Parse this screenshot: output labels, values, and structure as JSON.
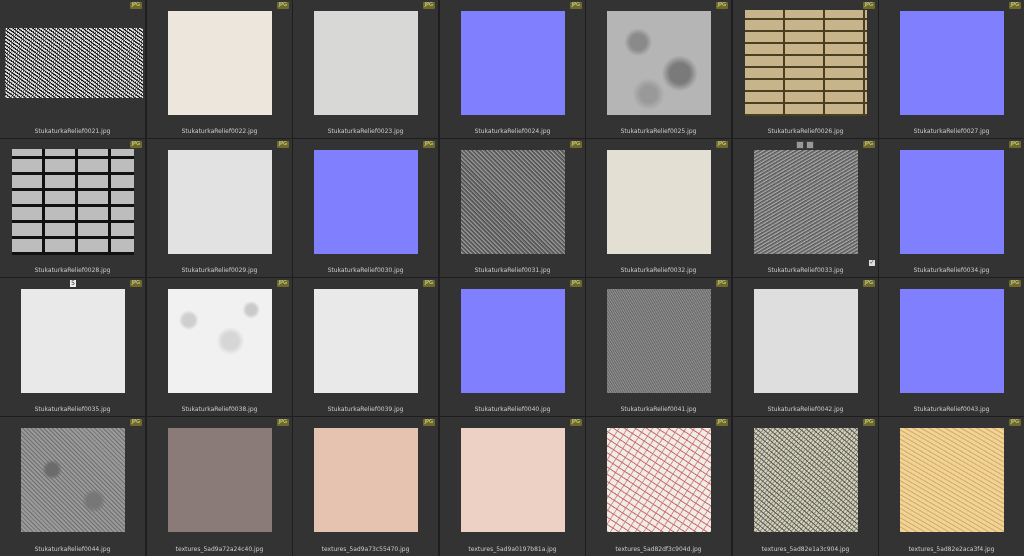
{
  "badge_text": "JPG",
  "items": [
    {
      "name": "StukaturkaRelief0021.jpg",
      "texture": "noise"
    },
    {
      "name": "StukaturkaRelief0022.jpg",
      "texture": "cream"
    },
    {
      "name": "StukaturkaRelief0023.jpg",
      "texture": "lightgray"
    },
    {
      "name": "StukaturkaRelief0024.jpg",
      "texture": "normal"
    },
    {
      "name": "StukaturkaRelief0025.jpg",
      "texture": "marble"
    },
    {
      "name": "StukaturkaRelief0026.jpg",
      "texture": "brick-gold"
    },
    {
      "name": "StukaturkaRelief0027.jpg",
      "texture": "normal"
    },
    {
      "name": "StukaturkaRelief0028.jpg",
      "texture": "brick-gray"
    },
    {
      "name": "StukaturkaRelief0029.jpg",
      "texture": "plaster"
    },
    {
      "name": "StukaturkaRelief0030.jpg",
      "texture": "normal"
    },
    {
      "name": "StukaturkaRelief0031.jpg",
      "texture": "rough"
    },
    {
      "name": "StukaturkaRelief0032.jpg",
      "texture": "beige"
    },
    {
      "name": "StukaturkaRelief0033.jpg",
      "texture": "rough2",
      "selected": true
    },
    {
      "name": "StukaturkaRelief0034.jpg",
      "texture": "normal"
    },
    {
      "name": "StukaturkaRelief0035.jpg",
      "texture": "white",
      "num": "5"
    },
    {
      "name": "StukaturkaRelief0038.jpg",
      "texture": "stucco"
    },
    {
      "name": "StukaturkaRelief0039.jpg",
      "texture": "white"
    },
    {
      "name": "StukaturkaRelief0040.jpg",
      "texture": "normal"
    },
    {
      "name": "StukaturkaRelief0041.jpg",
      "texture": "grayfine"
    },
    {
      "name": "StukaturkaRelief0042.jpg",
      "texture": "whitebump"
    },
    {
      "name": "StukaturkaRelief0043.jpg",
      "texture": "normal"
    },
    {
      "name": "StukaturkaRelief0044.jpg",
      "texture": "stone"
    },
    {
      "name": "textures_5ad9a72a24c40.jpg",
      "texture": "mauve"
    },
    {
      "name": "textures_5ad9a73c55470.jpg",
      "texture": "peach"
    },
    {
      "name": "textures_5ad9a0197b81a.jpg",
      "texture": "pinkbeige"
    },
    {
      "name": "textures_5ad82df3c904d.jpg",
      "texture": "speckred"
    },
    {
      "name": "textures_5ad82e1a3c904.jpg",
      "texture": "granite"
    },
    {
      "name": "textures_5ad82e2aca3f4.jpg",
      "texture": "yellow"
    }
  ]
}
